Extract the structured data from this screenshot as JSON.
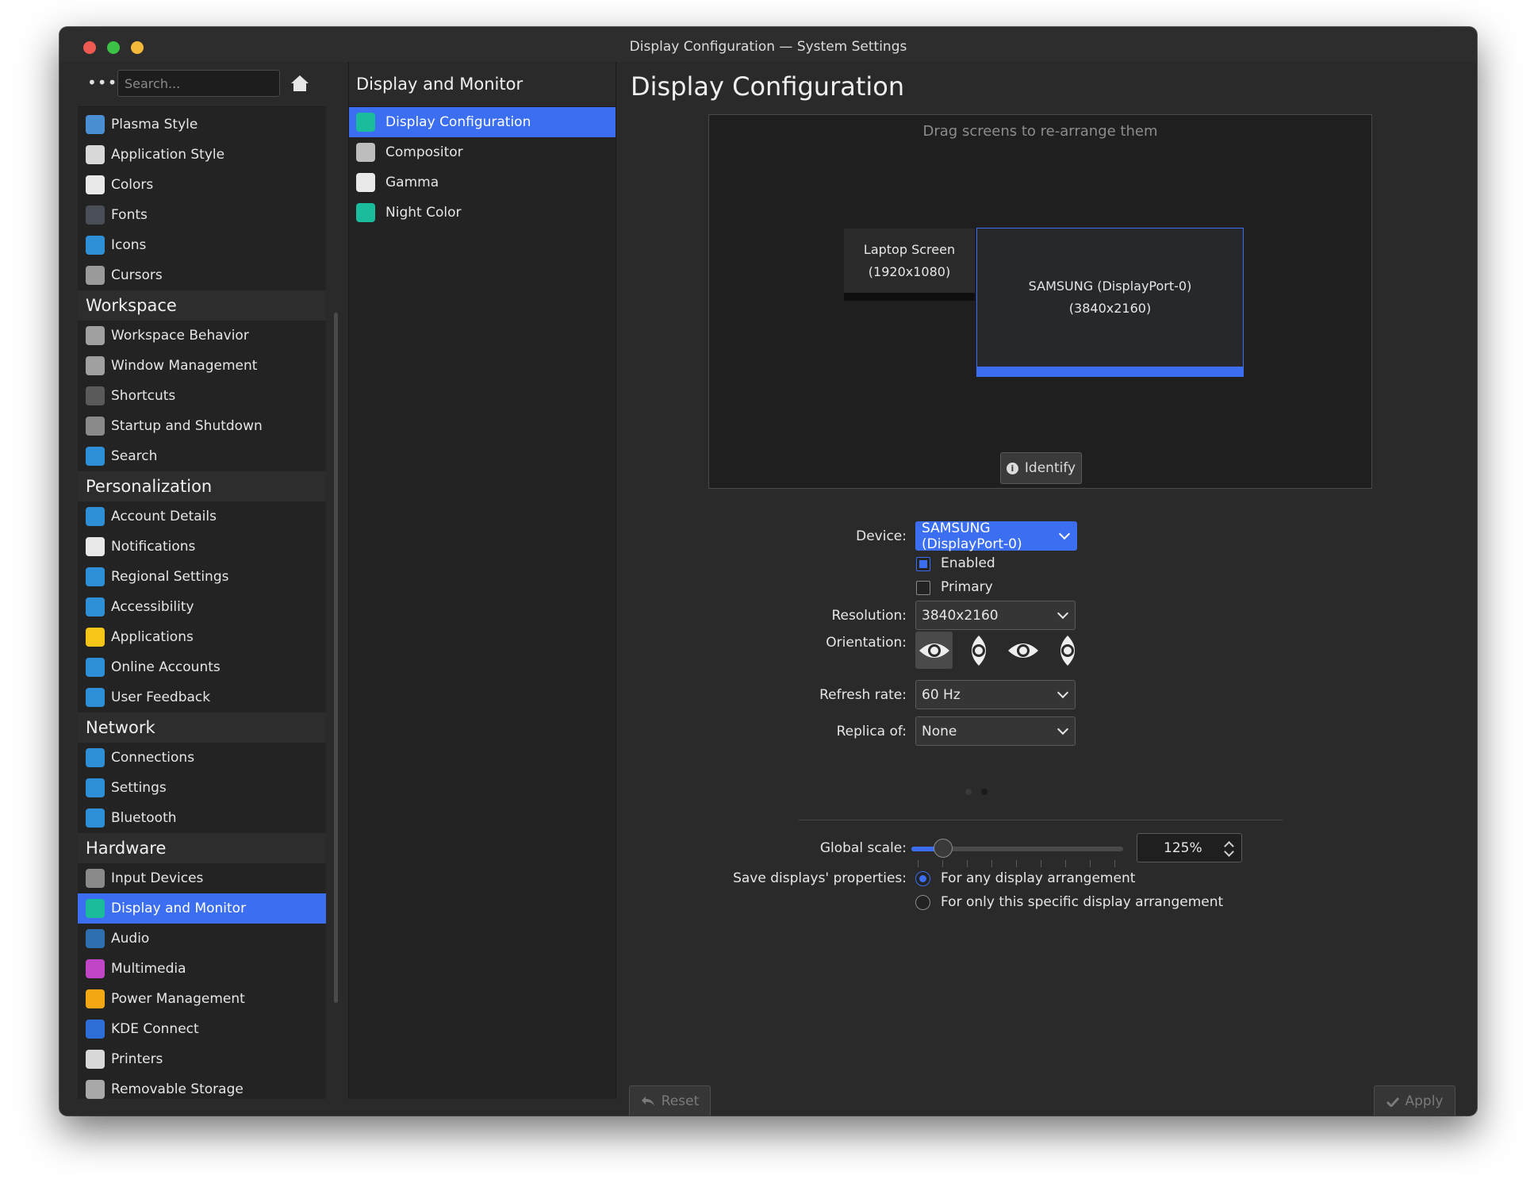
{
  "window": {
    "title": "Display Configuration — System Settings"
  },
  "sidebar": {
    "search_placeholder": "Search...",
    "items": [
      {
        "type": "item",
        "label": "Plasma Style",
        "icon": "plasma-style-icon",
        "color": "#4a8fd4"
      },
      {
        "type": "item",
        "label": "Application Style",
        "icon": "application-style-icon",
        "color": "#d8d8d8"
      },
      {
        "type": "item",
        "label": "Colors",
        "icon": "colors-icon",
        "color": "#e9e9e9"
      },
      {
        "type": "item",
        "label": "Fonts",
        "icon": "fonts-icon",
        "color": "#4a4f57"
      },
      {
        "type": "item",
        "label": "Icons",
        "icon": "icons-icon",
        "color": "#2d8fd6"
      },
      {
        "type": "item",
        "label": "Cursors",
        "icon": "cursors-icon",
        "color": "#9a9a9a"
      },
      {
        "type": "header",
        "label": "Workspace"
      },
      {
        "type": "item",
        "label": "Workspace Behavior",
        "icon": "workspace-behavior-icon",
        "color": "#a0a0a0"
      },
      {
        "type": "item",
        "label": "Window Management",
        "icon": "window-management-icon",
        "color": "#a0a0a0"
      },
      {
        "type": "item",
        "label": "Shortcuts",
        "icon": "shortcuts-icon",
        "color": "#5a5a5a"
      },
      {
        "type": "item",
        "label": "Startup and Shutdown",
        "icon": "startup-shutdown-icon",
        "color": "#8a8a8a"
      },
      {
        "type": "item",
        "label": "Search",
        "icon": "search-icon",
        "color": "#2d8fd6"
      },
      {
        "type": "header",
        "label": "Personalization"
      },
      {
        "type": "item",
        "label": "Account Details",
        "icon": "account-details-icon",
        "color": "#2d8fd6"
      },
      {
        "type": "item",
        "label": "Notifications",
        "icon": "notifications-icon",
        "color": "#e8e8e8"
      },
      {
        "type": "item",
        "label": "Regional Settings",
        "icon": "regional-settings-icon",
        "color": "#2d8fd6"
      },
      {
        "type": "item",
        "label": "Accessibility",
        "icon": "accessibility-icon",
        "color": "#2d8fd6"
      },
      {
        "type": "item",
        "label": "Applications",
        "icon": "applications-star-icon",
        "color": "#f5c518"
      },
      {
        "type": "item",
        "label": "Online Accounts",
        "icon": "online-accounts-icon",
        "color": "#2d8fd6"
      },
      {
        "type": "item",
        "label": "User Feedback",
        "icon": "user-feedback-icon",
        "color": "#2d8fd6"
      },
      {
        "type": "header",
        "label": "Network"
      },
      {
        "type": "item",
        "label": "Connections",
        "icon": "connections-icon",
        "color": "#2d8fd6"
      },
      {
        "type": "item",
        "label": "Settings",
        "icon": "network-settings-icon",
        "color": "#2d8fd6"
      },
      {
        "type": "item",
        "label": "Bluetooth",
        "icon": "bluetooth-icon",
        "color": "#2d8fd6"
      },
      {
        "type": "header",
        "label": "Hardware"
      },
      {
        "type": "item",
        "label": "Input Devices",
        "icon": "input-devices-icon",
        "color": "#8a8a8a"
      },
      {
        "type": "item",
        "label": "Display and Monitor",
        "icon": "display-monitor-icon",
        "color": "#1abc9c",
        "selected": true
      },
      {
        "type": "item",
        "label": "Audio",
        "icon": "audio-icon",
        "color": "#2d6fb0"
      },
      {
        "type": "item",
        "label": "Multimedia",
        "icon": "multimedia-icon",
        "color": "#c046c7"
      },
      {
        "type": "item",
        "label": "Power Management",
        "icon": "power-management-icon",
        "color": "#f3a712"
      },
      {
        "type": "item",
        "label": "KDE Connect",
        "icon": "kde-connect-icon",
        "color": "#2d6fd6"
      },
      {
        "type": "item",
        "label": "Printers",
        "icon": "printers-icon",
        "color": "#d8d8d8"
      },
      {
        "type": "item",
        "label": "Removable Storage",
        "icon": "removable-storage-icon",
        "color": "#a8a8a8"
      }
    ]
  },
  "middle": {
    "title": "Display and Monitor",
    "items": [
      {
        "label": "Display Configuration",
        "icon": "display-configuration-icon",
        "color": "#1abc9c",
        "selected": true
      },
      {
        "label": "Compositor",
        "icon": "compositor-icon",
        "color": "#bdbdbd"
      },
      {
        "label": "Gamma",
        "icon": "gamma-icon",
        "color": "#e9e9e9"
      },
      {
        "label": "Night Color",
        "icon": "night-color-icon",
        "color": "#1abc9c"
      }
    ]
  },
  "main": {
    "title": "Display Configuration",
    "arrange_hint": "Drag screens to re-arrange them",
    "screens": [
      {
        "name": "Laptop Screen",
        "res": "(1920x1080)"
      },
      {
        "name": "SAMSUNG (DisplayPort-0)",
        "res": "(3840x2160)"
      }
    ],
    "identify_label": "Identify",
    "device_label": "Device:",
    "device_value": "SAMSUNG (DisplayPort-0)",
    "enabled_label": "Enabled",
    "enabled": true,
    "primary_label": "Primary",
    "primary": false,
    "resolution_label": "Resolution:",
    "resolution_value": "3840x2160",
    "orientation_label": "Orientation:",
    "refresh_label": "Refresh rate:",
    "refresh_value": "60 Hz",
    "replica_label": "Replica of:",
    "replica_value": "None",
    "global_scale_label": "Global scale:",
    "global_scale_value": "125%",
    "global_scale_level": 0.15,
    "save_label": "Save displays' properties:",
    "save_option_any": "For any display arrangement",
    "save_option_specific": "For only this specific display arrangement",
    "reset_label": "Reset",
    "apply_label": "Apply"
  },
  "colors": {
    "accent": "#3b6ef0"
  }
}
